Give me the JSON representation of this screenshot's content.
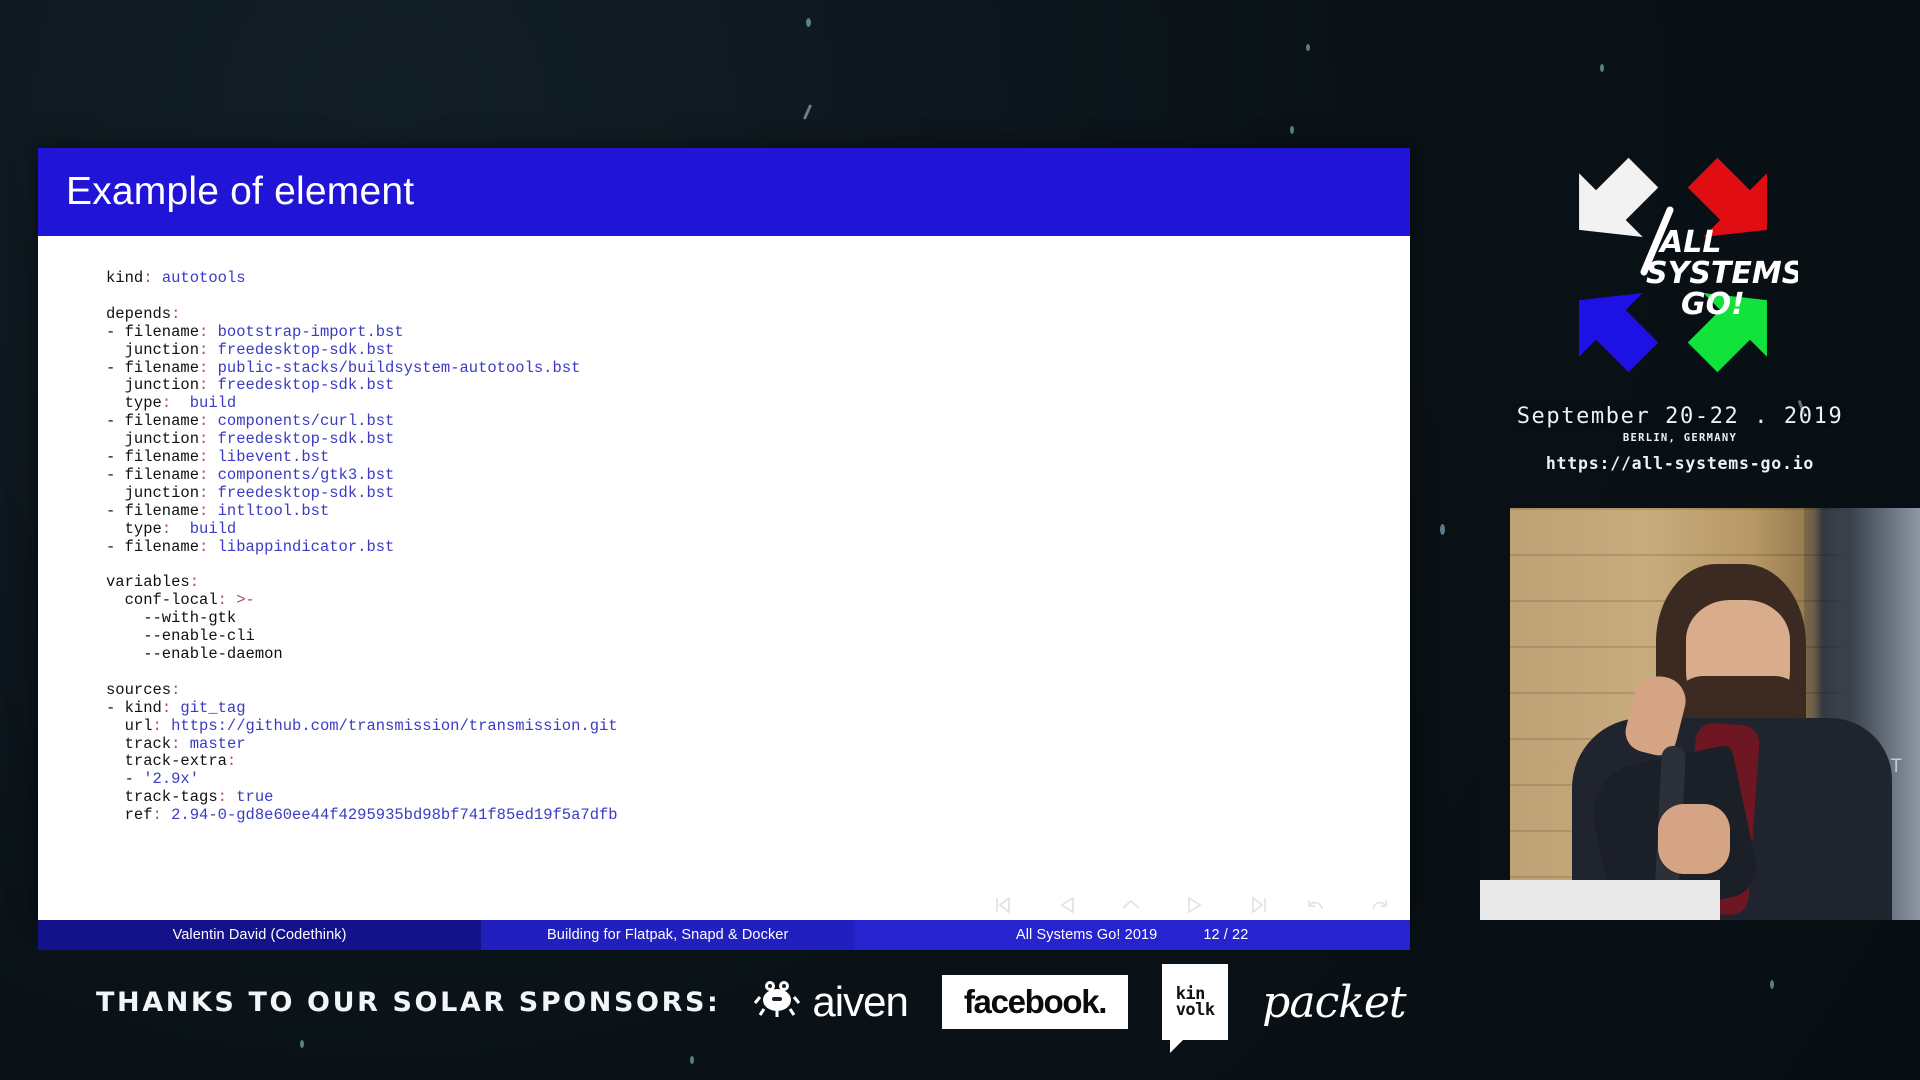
{
  "slide": {
    "title": "Example of element",
    "code_lines": [
      [
        {
          "t": "kind",
          "c": "key"
        },
        {
          "t": ":",
          "c": "pun"
        },
        {
          "t": " autotools",
          "c": "val"
        }
      ],
      [],
      [
        {
          "t": "depends",
          "c": "key"
        },
        {
          "t": ":",
          "c": "pun"
        }
      ],
      [
        {
          "t": "- filename",
          "c": "key"
        },
        {
          "t": ":",
          "c": "pun"
        },
        {
          "t": " bootstrap-import.bst",
          "c": "val"
        }
      ],
      [
        {
          "t": "  junction",
          "c": "key"
        },
        {
          "t": ":",
          "c": "pun"
        },
        {
          "t": " freedesktop-sdk.bst",
          "c": "val"
        }
      ],
      [
        {
          "t": "- filename",
          "c": "key"
        },
        {
          "t": ":",
          "c": "pun"
        },
        {
          "t": " public-stacks/buildsystem-autotools.bst",
          "c": "val"
        }
      ],
      [
        {
          "t": "  junction",
          "c": "key"
        },
        {
          "t": ":",
          "c": "pun"
        },
        {
          "t": " freedesktop-sdk.bst",
          "c": "val"
        }
      ],
      [
        {
          "t": "  type",
          "c": "key"
        },
        {
          "t": ":",
          "c": "pun"
        },
        {
          "t": "  build",
          "c": "val"
        }
      ],
      [
        {
          "t": "- filename",
          "c": "key"
        },
        {
          "t": ":",
          "c": "pun"
        },
        {
          "t": " components/curl.bst",
          "c": "val"
        }
      ],
      [
        {
          "t": "  junction",
          "c": "key"
        },
        {
          "t": ":",
          "c": "pun"
        },
        {
          "t": " freedesktop-sdk.bst",
          "c": "val"
        }
      ],
      [
        {
          "t": "- filename",
          "c": "key"
        },
        {
          "t": ":",
          "c": "pun"
        },
        {
          "t": " libevent.bst",
          "c": "val"
        }
      ],
      [
        {
          "t": "- filename",
          "c": "key"
        },
        {
          "t": ":",
          "c": "pun"
        },
        {
          "t": " components/gtk3.bst",
          "c": "val"
        }
      ],
      [
        {
          "t": "  junction",
          "c": "key"
        },
        {
          "t": ":",
          "c": "pun"
        },
        {
          "t": " freedesktop-sdk.bst",
          "c": "val"
        }
      ],
      [
        {
          "t": "- filename",
          "c": "key"
        },
        {
          "t": ":",
          "c": "pun"
        },
        {
          "t": " intltool.bst",
          "c": "val"
        }
      ],
      [
        {
          "t": "  type",
          "c": "key"
        },
        {
          "t": ":",
          "c": "pun"
        },
        {
          "t": "  build",
          "c": "val"
        }
      ],
      [
        {
          "t": "- filename",
          "c": "key"
        },
        {
          "t": ":",
          "c": "pun"
        },
        {
          "t": " libappindicator.bst",
          "c": "val"
        }
      ],
      [],
      [
        {
          "t": "variables",
          "c": "key"
        },
        {
          "t": ":",
          "c": "pun"
        }
      ],
      [
        {
          "t": "  conf-local",
          "c": "key"
        },
        {
          "t": ":",
          "c": "pun"
        },
        {
          "t": " >-",
          "c": "pun"
        }
      ],
      [
        {
          "t": "    --with-gtk",
          "c": "key"
        }
      ],
      [
        {
          "t": "    --enable-cli",
          "c": "key"
        }
      ],
      [
        {
          "t": "    --enable-daemon",
          "c": "key"
        }
      ],
      [],
      [
        {
          "t": "sources",
          "c": "key"
        },
        {
          "t": ":",
          "c": "pun"
        }
      ],
      [
        {
          "t": "- kind",
          "c": "key"
        },
        {
          "t": ":",
          "c": "pun"
        },
        {
          "t": " git_tag",
          "c": "val"
        }
      ],
      [
        {
          "t": "  url",
          "c": "key"
        },
        {
          "t": ": ",
          "c": "pun"
        },
        {
          "t": "https://github.com/transmission/transmission.git",
          "c": "val"
        }
      ],
      [
        {
          "t": "  track",
          "c": "key"
        },
        {
          "t": ":",
          "c": "pun"
        },
        {
          "t": " master",
          "c": "val"
        }
      ],
      [
        {
          "t": "  track-extra",
          "c": "key"
        },
        {
          "t": ":",
          "c": "pun"
        }
      ],
      [
        {
          "t": "  - ",
          "c": "key"
        },
        {
          "t": "'2.9x'",
          "c": "val"
        }
      ],
      [
        {
          "t": "  track-tags",
          "c": "key"
        },
        {
          "t": ":",
          "c": "pun"
        },
        {
          "t": " true",
          "c": "val"
        }
      ],
      [
        {
          "t": "  ref",
          "c": "key"
        },
        {
          "t": ":",
          "c": "pun"
        },
        {
          "t": " 2.94-0-gd8e60ee44f4295935bd98bf741f85ed19f5a7dfb",
          "c": "val"
        }
      ]
    ],
    "footer": {
      "author": "Valentin David  (Codethink)",
      "talk": "Building for Flatpak, Snapd & Docker",
      "event": "All Systems Go! 2019",
      "page": "12 / 22"
    },
    "nav_icons": [
      "first-slide-icon",
      "previous-slide-icon",
      "up-slide-icon",
      "next-slide-icon",
      "last-slide-icon",
      "back-icon",
      "forward-icon"
    ]
  },
  "conference": {
    "logo_text_line1": "ALL",
    "logo_text_line2": "SYSTEMS",
    "logo_text_line3": "GO!",
    "date": "September 20-22 . 2019",
    "city": "BERLIN, GERMANY",
    "url": "https://all-systems-go.io",
    "logo_colors": {
      "white": "#f2f2f2",
      "red": "#e00d12",
      "blue": "#1d11e6",
      "green": "#12e23c"
    }
  },
  "sponsors": {
    "label": "THANKS TO OUR SOLAR SPONSORS:",
    "items": [
      {
        "name": "aiven",
        "label": "aiven"
      },
      {
        "name": "facebook",
        "label": "facebook."
      },
      {
        "name": "kinvolk",
        "label_top": "kin",
        "label_bottom": "volk"
      },
      {
        "name": "packet",
        "label": "packet"
      }
    ]
  },
  "video": {
    "overlay_letter": "T"
  },
  "theme": {
    "slide_header": "#2015d6",
    "footer_left": "#14128a",
    "footer_mid": "#211fbe",
    "footer_right": "#2723ce",
    "code_value": "#3b3bc4",
    "background": "#0c1419"
  }
}
